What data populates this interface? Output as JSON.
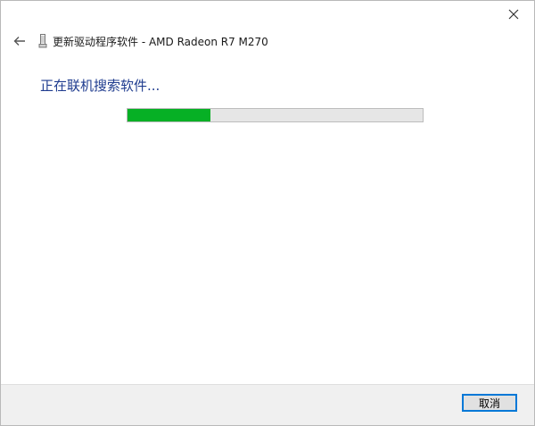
{
  "window": {
    "title": "更新驱动程序软件 - AMD Radeon R7 M270"
  },
  "icons": {
    "close": "close-icon",
    "back": "back-arrow-icon",
    "device": "device-icon"
  },
  "main": {
    "status_text": "正在联机搜索软件...",
    "progress_percent": 28
  },
  "footer": {
    "cancel_label": "取消"
  },
  "colors": {
    "status_text": "#1f3c8f",
    "progress_fill": "#06b025",
    "progress_track": "#e6e6e6",
    "button_border": "#0078d7"
  }
}
